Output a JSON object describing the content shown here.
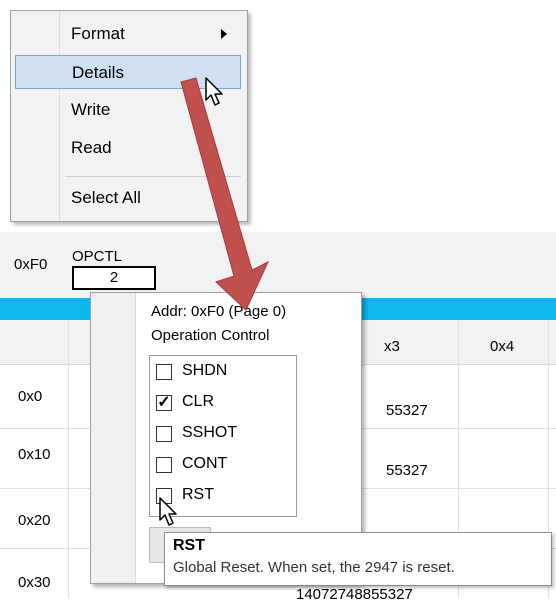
{
  "context_menu": {
    "items": [
      {
        "label": "Format"
      },
      {
        "label": "Details"
      },
      {
        "label": "Write"
      },
      {
        "label": "Read"
      },
      {
        "label": "Select All"
      }
    ]
  },
  "register": {
    "address": "0xF0",
    "name": "OPCTL",
    "value": "2"
  },
  "grid": {
    "columns": [
      "x3",
      "0x4"
    ],
    "rows": [
      {
        "addr": "0x0",
        "value": "55327"
      },
      {
        "addr": "0x10",
        "value": "55327"
      },
      {
        "addr": "0x20",
        "value": ""
      },
      {
        "addr": "0x30",
        "value": "14072748855327"
      }
    ]
  },
  "details": {
    "address_line": "Addr: 0xF0 (Page 0)",
    "description": "Operation Control",
    "bits": [
      {
        "name": "SHDN",
        "checked": false
      },
      {
        "name": "CLR",
        "checked": true
      },
      {
        "name": "SSHOT",
        "checked": false
      },
      {
        "name": "CONT",
        "checked": false
      },
      {
        "name": "RST",
        "checked": false
      }
    ]
  },
  "tooltip": {
    "title": "RST",
    "body": "Global Reset. When set, the 2947 is reset."
  },
  "colors": {
    "menu_bg": "#f2f2f2",
    "menu_highlight": "#cfe0f3",
    "blue_bar": "#0cb7ee",
    "annotation_arrow": "#c0504d"
  },
  "icons": {
    "submenu": "chevron-right-icon",
    "check": "checkmark-icon",
    "cursor": "mouse-pointer-icon",
    "annotation": "arrow-annotation"
  }
}
